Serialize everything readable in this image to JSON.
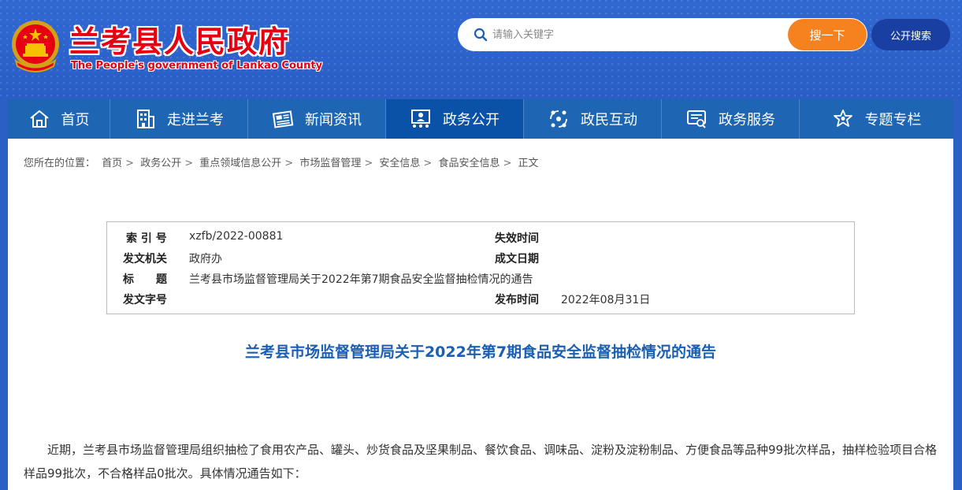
{
  "header": {
    "site_title": "兰考县人民政府",
    "site_subtitle": "The People's government of Lankao County",
    "search_placeholder": "请输入关键字",
    "search_button": "搜一下",
    "public_search_button": "公开搜索"
  },
  "nav": {
    "items": [
      {
        "label": "首页",
        "icon": "home-icon"
      },
      {
        "label": "走进兰考",
        "icon": "building-icon"
      },
      {
        "label": "新闻资讯",
        "icon": "newspaper-icon"
      },
      {
        "label": "政务公开",
        "icon": "government-icon",
        "active": true
      },
      {
        "label": "政民互动",
        "icon": "interaction-icon"
      },
      {
        "label": "政务服务",
        "icon": "service-icon"
      },
      {
        "label": "专题专栏",
        "icon": "topic-icon"
      }
    ]
  },
  "breadcrumb": {
    "prefix": "您所在的位置：",
    "items": [
      "首页",
      "政务公开",
      "重点领域信息公开",
      "市场监督管理",
      "安全信息",
      "食品安全信息",
      "正文"
    ]
  },
  "meta": {
    "index_label": "索 引 号",
    "index_value": "xzfb/2022-00881",
    "expire_label": "失效时间",
    "expire_value": "",
    "issuer_label": "发文机关",
    "issuer_value": "政府办",
    "created_label": "成文日期",
    "created_value": "",
    "title_label": "标　　题",
    "title_value": "兰考县市场监督管理局关于2022年第7期食品安全监督抽检情况的通告",
    "docno_label": "发文字号",
    "docno_value": "",
    "publish_label": "发布时间",
    "publish_value": "2022年08月31日"
  },
  "article": {
    "title": "兰考县市场监督管理局关于2022年第7期食品安全监督抽检情况的通告",
    "paragraph": "近期，兰考县市场监督管理局组织抽检了食用农产品、罐头、炒货食品及坚果制品、餐饮食品、调味品、淀粉及淀粉制品、方便食品等品种99批次样品，抽样检验项目合格样品99批次，不合格样品0批次。具体情况通告如下："
  },
  "colors": {
    "header_bg": "#2a5fc4",
    "nav_bg": "#1e66b4",
    "nav_active": "#0a52a8",
    "search_button": "#f5821f",
    "title_red": "#e60012",
    "article_title": "#1a5fb4"
  }
}
